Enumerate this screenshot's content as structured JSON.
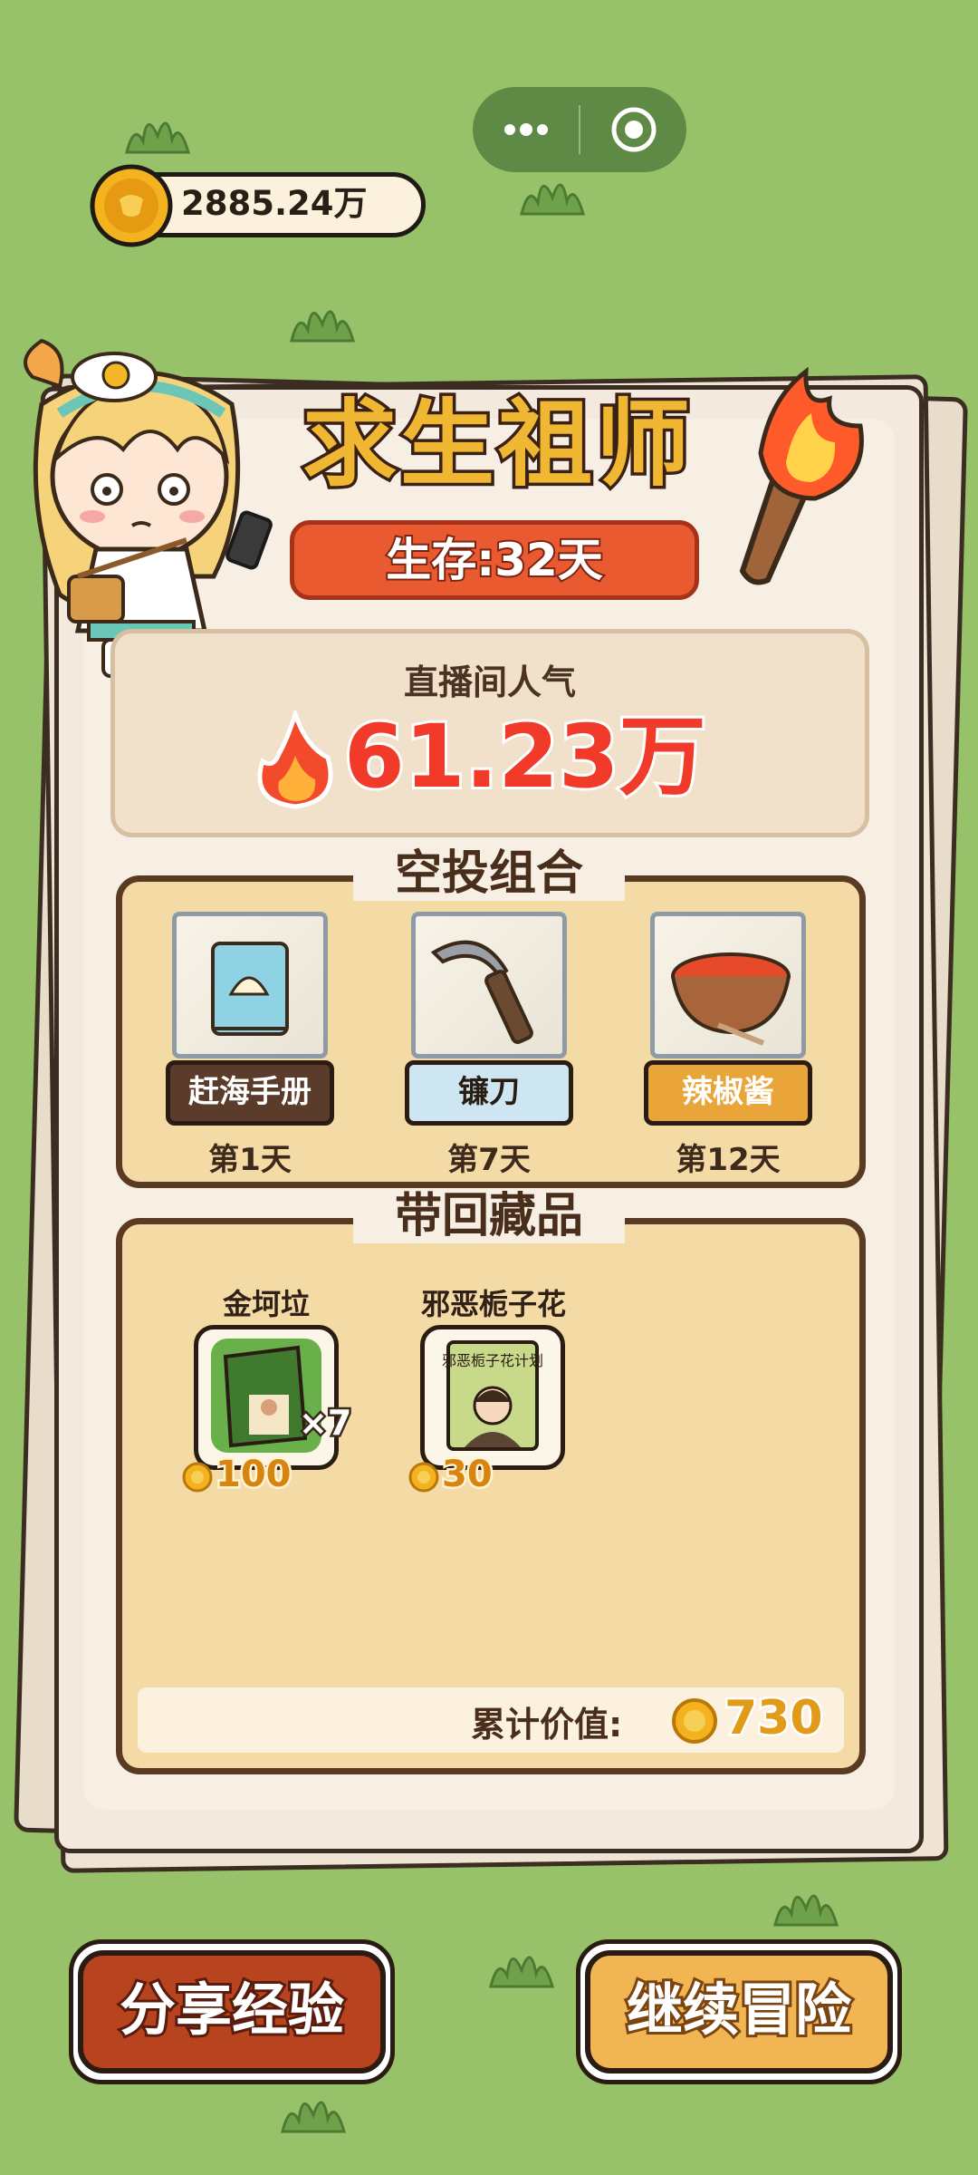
{
  "header": {
    "coin_balance": "2885.24万",
    "menu_icons": [
      "more-dots-icon",
      "target-close-icon"
    ]
  },
  "panel": {
    "title": "求生祖师",
    "survival": "生存:32天",
    "popularity_label": "直播间人气",
    "popularity_value": "61.23万"
  },
  "airdrop": {
    "title": "空投组合",
    "items": [
      {
        "name": "赶海手册",
        "day": "第1天",
        "label_bg": "#5b3b2a",
        "label_color": "#ffffff",
        "icon": "book-shell-icon"
      },
      {
        "name": "镰刀",
        "day": "第7天",
        "label_bg": "#cde6f2",
        "label_color": "#2a1c12",
        "icon": "sickle-icon"
      },
      {
        "name": "辣椒酱",
        "day": "第12天",
        "label_bg": "#e9a53a",
        "label_color": "#ffffff",
        "icon": "chili-sauce-bowl-icon"
      }
    ]
  },
  "collection": {
    "title": "带回藏品",
    "items": [
      {
        "name": "金坷垃",
        "price": "100",
        "count": "×7",
        "icon": "fertilizer-bag-icon"
      },
      {
        "name": "邪恶栀子花",
        "price": "30",
        "count": "",
        "icon": "book-portrait-icon",
        "book_text": "邪恶栀子花计划"
      }
    ],
    "total_label": "累计价值:",
    "total_value": "730"
  },
  "buttons": {
    "share": "分享经验",
    "continue": "继续冒险"
  }
}
